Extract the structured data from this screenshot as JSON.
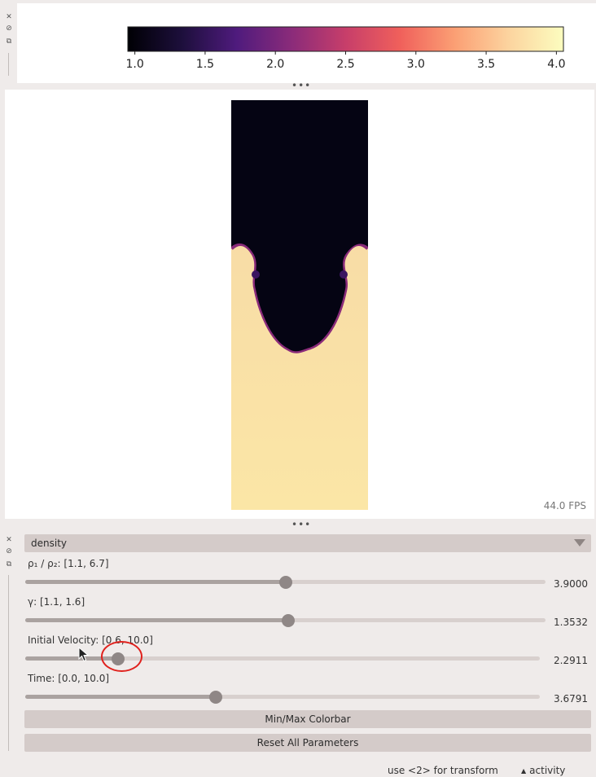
{
  "colorbar": {
    "tick_labels": [
      "1.0",
      "1.5",
      "2.0",
      "2.5",
      "3.0",
      "3.5",
      "4.0"
    ],
    "min": 0.95,
    "max": 4.05,
    "colormap_stops": [
      "#000004",
      "#1d0f3c",
      "#4f1b7d",
      "#8a2b7a",
      "#c73e6a",
      "#f0605b",
      "#fb9f74",
      "#fcd49f",
      "#fcfdbf"
    ]
  },
  "canvas": {
    "fps_label": "44.0 FPS",
    "dark_color": "#050413",
    "light_color": "#fbe3a8"
  },
  "layer_select": {
    "value": "density"
  },
  "params": [
    {
      "label": "ρ₁ / ρ₂: [1.1, 6.7]",
      "value": "3.9000",
      "fraction": 0.5
    },
    {
      "label": "γ: [1.1, 1.6]",
      "value": "1.3532",
      "fraction": 0.506
    },
    {
      "label": "Initial Velocity: [0.6, 10.0]",
      "value": "2.2911",
      "fraction": 0.18
    },
    {
      "label": "Time: [0.0, 10.0]",
      "value": "3.6791",
      "fraction": 0.37
    }
  ],
  "buttons": {
    "minmax": "Min/Max Colorbar",
    "reset": "Reset All Parameters"
  },
  "dock_icons": [
    "close-icon",
    "float-icon",
    "detach-icon"
  ],
  "handle_text": "•••",
  "status": {
    "hint": "use <2> for transform",
    "activity": "activity",
    "activity_caret": "▲"
  }
}
